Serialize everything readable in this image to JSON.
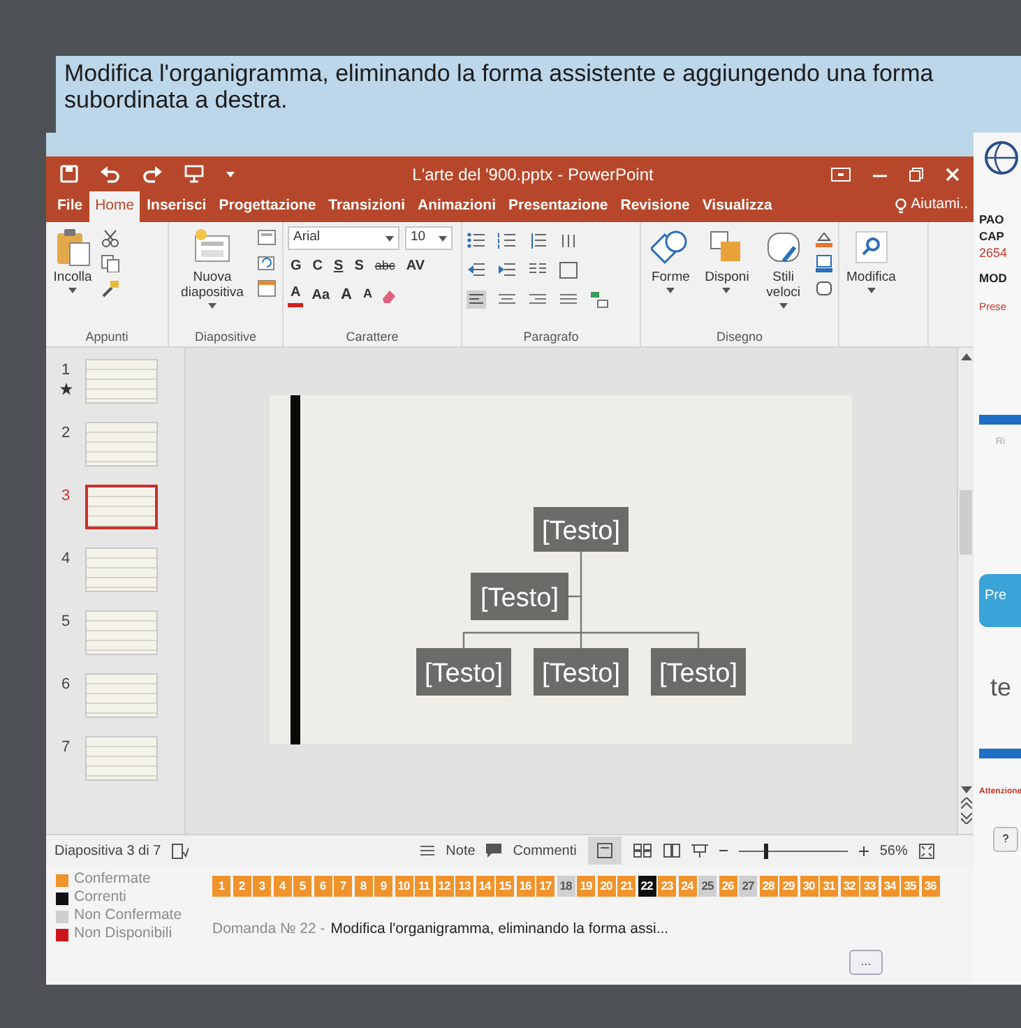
{
  "question_banner": {
    "text": "Modifica l'organigramma, eliminando la forma assistente e aggiungendo una forma subordinata a destra."
  },
  "powerpoint": {
    "title": "L'arte del '900.pptx - PowerPoint",
    "tabs": [
      {
        "label": "File",
        "selected": false
      },
      {
        "label": "Home",
        "selected": true
      },
      {
        "label": "Inserisci",
        "selected": false
      },
      {
        "label": "Progettazione",
        "selected": false
      },
      {
        "label": "Transizioni",
        "selected": false
      },
      {
        "label": "Animazioni",
        "selected": false
      },
      {
        "label": "Presentazione",
        "selected": false
      },
      {
        "label": "Revisione",
        "selected": false
      },
      {
        "label": "Visualizza",
        "selected": false
      }
    ],
    "help_search": "Aiutami..",
    "ribbon": {
      "clipboard": {
        "paste": "Incolla",
        "label": "Appunti"
      },
      "slides": {
        "new_slide": "Nuova diapositiva",
        "label": "Diapositive"
      },
      "font": {
        "family": "Arial",
        "size": "10",
        "format_buttons": [
          "G",
          "C",
          "S",
          "S",
          "abc",
          "AV"
        ],
        "color_button": "A",
        "case_button": "Aa",
        "grow_buttons": [
          "A",
          "A"
        ],
        "label": "Carattere"
      },
      "paragraph": {
        "label": "Paragrafo"
      },
      "drawing": {
        "buttons": [
          "Forme",
          "Disponi",
          "Stili veloci"
        ],
        "label": "Disegno"
      },
      "editing": {
        "button": "Modifica"
      }
    },
    "slides": [
      {
        "number": "1",
        "selected": false,
        "has_star": true
      },
      {
        "number": "2",
        "selected": false,
        "has_star": false
      },
      {
        "number": "3",
        "selected": true,
        "has_star": false
      },
      {
        "number": "4",
        "selected": false,
        "has_star": false
      },
      {
        "number": "5",
        "selected": false,
        "has_star": false
      },
      {
        "number": "6",
        "selected": false,
        "has_star": false
      },
      {
        "number": "7",
        "selected": false,
        "has_star": false
      }
    ],
    "slide": {
      "org_chart": [
        {
          "kind": "top",
          "text": "[Testo]"
        },
        {
          "kind": "assistant",
          "text": "[Testo]"
        },
        {
          "kind": "subordinate",
          "text": "[Testo]"
        },
        {
          "kind": "subordinate",
          "text": "[Testo]"
        },
        {
          "kind": "subordinate",
          "text": "[Testo]"
        }
      ]
    },
    "status_bar": {
      "slide_counter": "Diapositiva 3 di 7",
      "notes": "Note",
      "comments": "Commenti",
      "zoom": {
        "level": 0.25,
        "reading": "56%"
      }
    }
  },
  "side_panel": {
    "user_lines": [
      "PAO",
      "CAP"
    ],
    "code": "2654",
    "mode": "MOD",
    "link": "Prese",
    "caption": "Ri",
    "button": "Pre",
    "big_text": "te",
    "warning": "Attenzione",
    "help_button": "?"
  },
  "exam_bar": {
    "legend": [
      {
        "label": "Confermate",
        "color": "#f0932b"
      },
      {
        "label": "Correnti",
        "color": "#111111"
      },
      {
        "label": "Non Confermate",
        "color": "#cfcfcf"
      },
      {
        "label": "Non Disponibili",
        "color": "#d0141b"
      }
    ],
    "questions": [
      {
        "number": "1",
        "kind": "confirmed"
      },
      {
        "number": "2",
        "kind": "confirmed"
      },
      {
        "number": "3",
        "kind": "confirmed"
      },
      {
        "number": "4",
        "kind": "confirmed"
      },
      {
        "number": "5",
        "kind": "confirmed"
      },
      {
        "number": "6",
        "kind": "confirmed"
      },
      {
        "number": "7",
        "kind": "confirmed"
      },
      {
        "number": "8",
        "kind": "confirmed"
      },
      {
        "number": "9",
        "kind": "confirmed"
      },
      {
        "number": "10",
        "kind": "confirmed"
      },
      {
        "number": "11",
        "kind": "confirmed"
      },
      {
        "number": "12",
        "kind": "confirmed"
      },
      {
        "number": "13",
        "kind": "confirmed"
      },
      {
        "number": "14",
        "kind": "confirmed"
      },
      {
        "number": "15",
        "kind": "confirmed"
      },
      {
        "number": "16",
        "kind": "confirmed"
      },
      {
        "number": "17",
        "kind": "confirmed"
      },
      {
        "number": "18",
        "kind": "unconfirmed"
      },
      {
        "number": "19",
        "kind": "confirmed"
      },
      {
        "number": "20",
        "kind": "confirmed"
      },
      {
        "number": "21",
        "kind": "confirmed"
      },
      {
        "number": "22",
        "kind": "current"
      },
      {
        "number": "23",
        "kind": "confirmed"
      },
      {
        "number": "24",
        "kind": "confirmed"
      },
      {
        "number": "25",
        "kind": "unconfirmed"
      },
      {
        "number": "26",
        "kind": "confirmed"
      },
      {
        "number": "27",
        "kind": "unconfirmed"
      },
      {
        "number": "28",
        "kind": "confirmed"
      },
      {
        "number": "29",
        "kind": "confirmed"
      },
      {
        "number": "30",
        "kind": "confirmed"
      },
      {
        "number": "31",
        "kind": "confirmed"
      },
      {
        "number": "32",
        "kind": "confirmed"
      },
      {
        "number": "33",
        "kind": "confirmed"
      },
      {
        "number": "34",
        "kind": "confirmed"
      },
      {
        "number": "35",
        "kind": "confirmed"
      },
      {
        "number": "36",
        "kind": "confirmed"
      }
    ],
    "question_label": "Domanda № 22 -",
    "question_text": "Modifica l'organigramma, eliminando la forma assi...",
    "more_button": "..."
  }
}
